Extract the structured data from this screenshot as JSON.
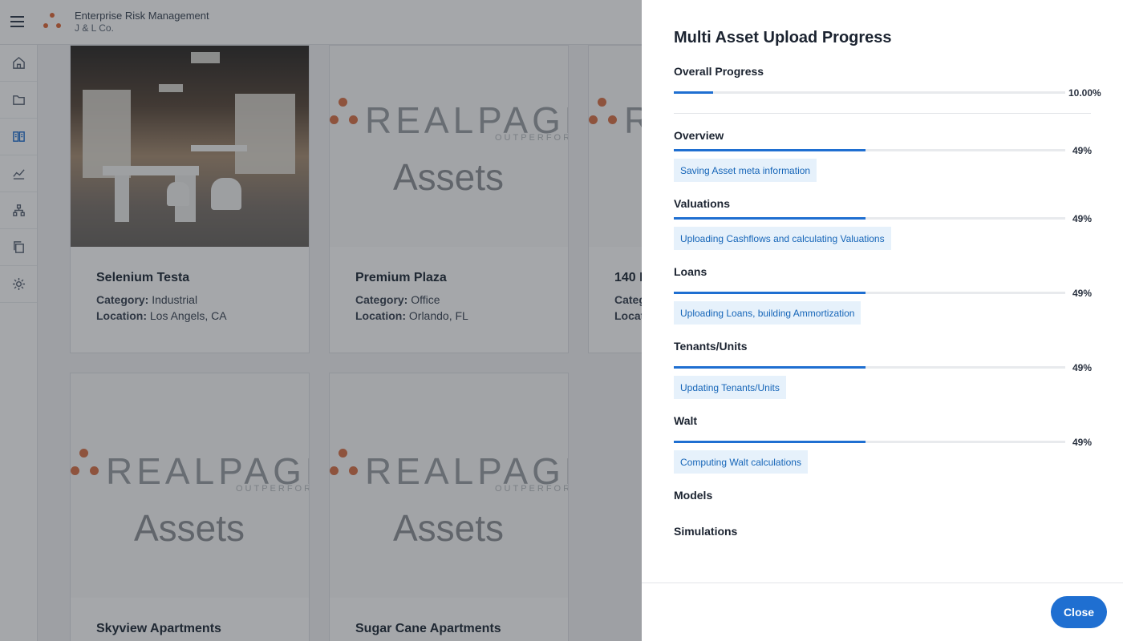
{
  "header": {
    "app_title": "Enterprise Risk Management",
    "org_name": "J & L Co."
  },
  "sidebar": {
    "items": [
      {
        "icon": "home-icon"
      },
      {
        "icon": "folder-icon"
      },
      {
        "icon": "assets-icon",
        "active": true
      },
      {
        "icon": "chart-icon"
      },
      {
        "icon": "hierarchy-icon"
      },
      {
        "icon": "copy-icon"
      },
      {
        "icon": "gear-icon"
      }
    ]
  },
  "placeholder": {
    "brand": "REALPAGE",
    "tagline": "OUTPERFORM",
    "assets_text": "Assets"
  },
  "cards": [
    {
      "name": "Selenium Testa",
      "category_label": "Category:",
      "category": "Industrial",
      "location_label": "Location:",
      "location": "Los Angels, CA",
      "image": "photo"
    },
    {
      "name": "Premium Plaza",
      "category_label": "Category:",
      "category": "Office",
      "location_label": "Location:",
      "location": "Orlando, FL",
      "image": "placeholder"
    },
    {
      "name": "140 I",
      "category_label": "Categ",
      "category": "",
      "location_label": "Locat",
      "location": "",
      "image": "placeholder"
    },
    {
      "name": "Skyview Apartments",
      "image": "placeholder"
    },
    {
      "name": "Sugar Cane Apartments",
      "image": "placeholder"
    }
  ],
  "modal": {
    "title": "Multi Asset Upload Progress",
    "overall": {
      "label": "Overall Progress",
      "value": 10.0,
      "percent_text": "10.00%"
    },
    "sections": [
      {
        "label": "Overview",
        "value": 49,
        "percent_text": "49%",
        "status": "Saving Asset meta information"
      },
      {
        "label": "Valuations",
        "value": 49,
        "percent_text": "49%",
        "status": "Uploading Cashflows and calculating Valuations"
      },
      {
        "label": "Loans",
        "value": 49,
        "percent_text": "49%",
        "status": "Uploading Loans, building Ammortization"
      },
      {
        "label": "Tenants/Units",
        "value": 49,
        "percent_text": "49%",
        "status": "Updating Tenants/Units"
      },
      {
        "label": "Walt",
        "value": 49,
        "percent_text": "49%",
        "status": "Computing Walt calculations"
      },
      {
        "label": "Models"
      },
      {
        "label": "Simulations"
      }
    ],
    "close_label": "Close",
    "accent_color": "#1f6fd1"
  }
}
